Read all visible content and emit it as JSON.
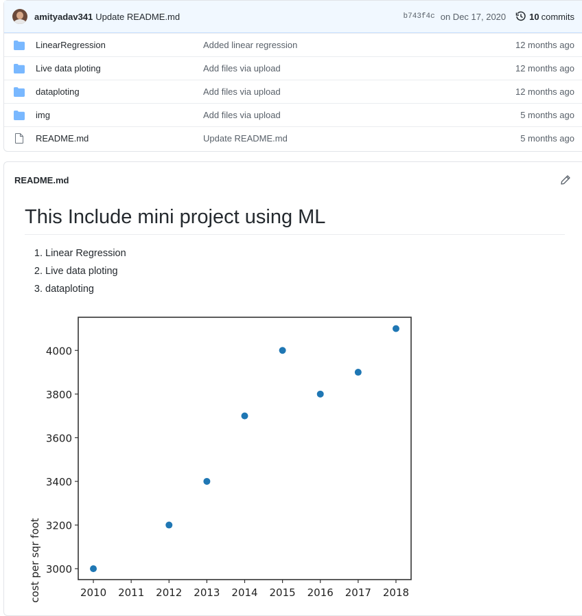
{
  "commit": {
    "author": "amityadav341",
    "message": "Update README.md",
    "sha": "b743f4c",
    "date": "on Dec 17, 2020",
    "count": "10",
    "count_label": "commits"
  },
  "files": [
    {
      "name": "LinearRegression",
      "message": "Added linear regression",
      "age": "12 months ago",
      "type": "folder"
    },
    {
      "name": "Live data ploting",
      "message": "Add files via upload",
      "age": "12 months ago",
      "type": "folder"
    },
    {
      "name": "dataploting",
      "message": "Add files via upload",
      "age": "12 months ago",
      "type": "folder"
    },
    {
      "name": "img",
      "message": "Add files via upload",
      "age": "5 months ago",
      "type": "folder"
    },
    {
      "name": "README.md",
      "message": "Update README.md",
      "age": "5 months ago",
      "type": "file"
    }
  ],
  "readme": {
    "filename": "README.md",
    "heading": "This Include mini project using ML",
    "list": [
      "Linear Regression",
      "Live data ploting",
      "dataploting"
    ]
  },
  "colors": {
    "folder": "#79b8ff",
    "point": "#1f77b4",
    "accent": "#0366d6"
  },
  "chart_data": {
    "type": "scatter",
    "title": "",
    "xlabel": "",
    "ylabel": "cost per sqr foot",
    "x": [
      2010,
      2012,
      2013,
      2014,
      2015,
      2016,
      2017,
      2018
    ],
    "y": [
      3000,
      3200,
      3400,
      3700,
      4000,
      3800,
      3900,
      4100
    ],
    "xticks": [
      2010,
      2011,
      2012,
      2013,
      2014,
      2015,
      2016,
      2017,
      2018
    ],
    "yticks": [
      3000,
      3200,
      3400,
      3600,
      3800,
      4000
    ],
    "xlim": [
      2009.6,
      2018.4
    ],
    "ylim": [
      2950,
      4155
    ],
    "grid": false
  }
}
